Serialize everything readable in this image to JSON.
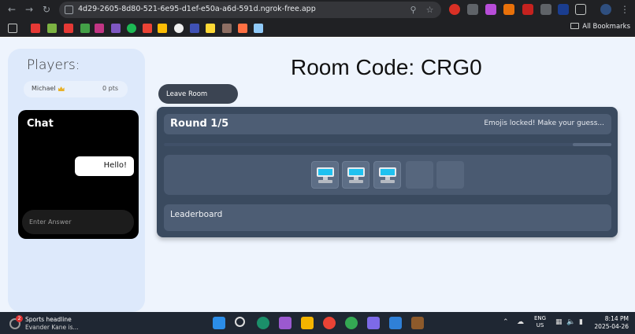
{
  "browser": {
    "url": "4d29-2605-8d80-521-6e95-d1ef-e50a-a6d-591d.ngrok-free.app",
    "all_bookmarks": "All Bookmarks"
  },
  "sidebar": {
    "players_title": "Players:",
    "players": [
      {
        "name": "Michael",
        "points": "0 pts"
      }
    ]
  },
  "chat": {
    "title": "Chat",
    "messages": [
      "Hello!"
    ],
    "input_placeholder": "Enter Answer"
  },
  "room": {
    "code_label": "Room Code: CRG0",
    "leave_button": "Leave Room"
  },
  "game": {
    "round_label": "Round 1/5",
    "status": "Emojis locked! Make your guess...",
    "emoji_slots": [
      "desktop-computer",
      "desktop-computer",
      "desktop-computer",
      "",
      ""
    ],
    "leaderboard_title": "Leaderboard"
  },
  "taskbar": {
    "news_title": "Sports headline",
    "news_text": "Evander Kane is...",
    "news_badge": "2",
    "lang_line1": "ENG",
    "lang_line2": "US",
    "time": "8:14 PM",
    "date": "2025-04-26"
  }
}
